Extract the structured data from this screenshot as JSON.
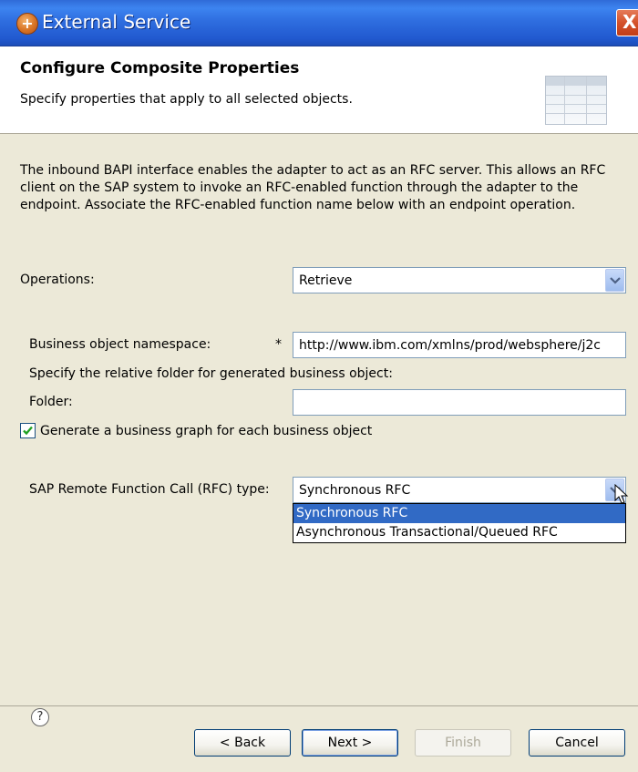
{
  "window": {
    "title": "External Service",
    "close_glyph": "X"
  },
  "header": {
    "title": "Configure Composite Properties",
    "description": "Specify properties that apply to all selected objects."
  },
  "body": {
    "intro": "The inbound BAPI interface enables the adapter to act as an RFC server.  This allows an RFC client on the SAP system to invoke an RFC-enabled function through the adapter to the endpoint. Associate the RFC-enabled function name below with an endpoint operation.",
    "operations_label": "Operations:",
    "operations_value": "Retrieve",
    "namespace_label": "Business object namespace:",
    "required_marker": "*",
    "namespace_value": "http://www.ibm.com/xmlns/prod/websphere/j2c",
    "folder_hint": "Specify the relative folder for generated business object:",
    "folder_label": "Folder:",
    "folder_value": "",
    "business_graph_label": "Generate a business graph for each business object",
    "business_graph_checked": true,
    "rfc_type_label": "SAP Remote Function Call (RFC) type:",
    "rfc_type_value": "Synchronous RFC",
    "rfc_type_options": [
      "Synchronous RFC",
      "Asynchronous Transactional/Queued RFC"
    ]
  },
  "footer": {
    "help_glyph": "?",
    "back_label": "< Back",
    "next_label": "Next >",
    "finish_label": "Finish",
    "cancel_label": "Cancel"
  },
  "colors": {
    "titlebar": "#2f6ee0",
    "selection": "#316ac5",
    "dialog_bg": "#ece9d8"
  }
}
